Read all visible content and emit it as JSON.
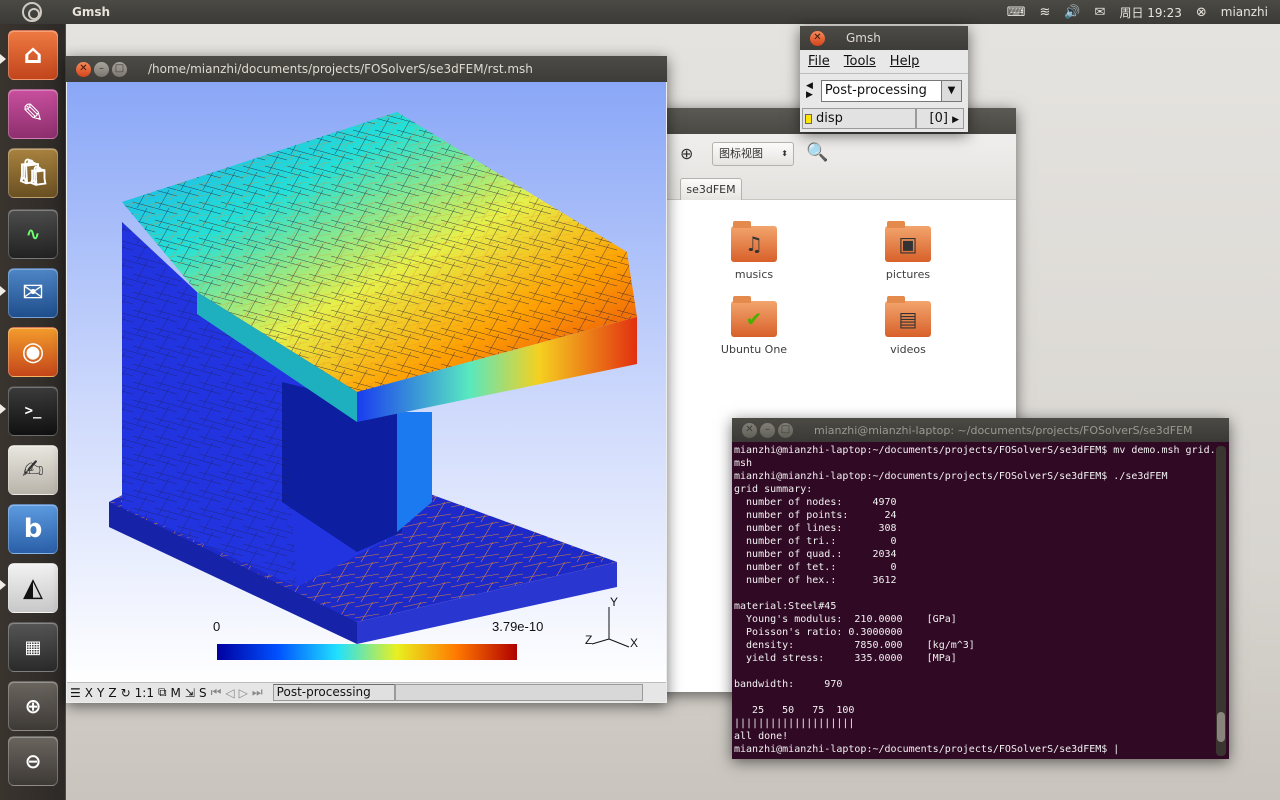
{
  "topbar": {
    "app_name": "Gmsh",
    "indicators": [
      "keyboard-icon",
      "wifi-icon",
      "volume-icon",
      "mail-icon"
    ],
    "clock": "周日 19:23",
    "user": "mianzhi"
  },
  "launcher": {
    "items": [
      "home-folder-icon",
      "system-settings-icon",
      "software-center-icon",
      "system-monitor-icon",
      "thunderbird-icon",
      "firefox-icon",
      "terminal-icon",
      "text-editor-icon",
      "blender-icon",
      "gmsh-icon",
      "workspace-switcher-icon",
      "zoom-icon",
      "zoom-out-icon",
      "trash-icon"
    ]
  },
  "gmsh_graphics": {
    "title": "/home/mianzhi/documents/projects/FOSolverS/se3dFEM/rst.msh",
    "colorbar_min": "0",
    "colorbar_max": "3.79e-10",
    "axis_x": "X",
    "axis_y": "Y",
    "axis_z": "Z",
    "status_buttons": [
      "X",
      "Y",
      "Z",
      "1:1",
      "M",
      "S"
    ],
    "status_module": "Post-processing"
  },
  "gmsh_menu": {
    "title": "Gmsh",
    "menus": [
      "File",
      "Tools",
      "Help"
    ],
    "module": "Post-processing",
    "view_name": "disp",
    "view_index": "[0]"
  },
  "nautilus": {
    "view_mode": "图标视图",
    "breadcrumb": "se3dFEM",
    "files": [
      "musics",
      "pictures",
      "Ubuntu One",
      "videos"
    ]
  },
  "terminal": {
    "title": "mianzhi@mianzhi-laptop: ~/documents/projects/FOSolverS/se3dFEM",
    "lines": [
      "mianzhi@mianzhi-laptop:~/documents/projects/FOSolverS/se3dFEM$ mv demo.msh grid.",
      "msh",
      "mianzhi@mianzhi-laptop:~/documents/projects/FOSolverS/se3dFEM$ ./se3dFEM",
      "grid summary:",
      "  number of nodes:     4970",
      "  number of points:      24",
      "  number of lines:      308",
      "  number of tri.:         0",
      "  number of quad.:     2034",
      "  number of tet.:         0",
      "  number of hex.:      3612",
      "",
      "material:Steel#45",
      "  Young's modulus:  210.0000    [GPa]",
      "  Poisson's ratio: 0.3000000",
      "  density:          7850.000    [kg/m^3]",
      "  yield stress:     335.0000    [MPa]",
      "",
      "bandwidth:     970",
      "",
      "   25   50   75  100",
      "||||||||||||||||||||",
      "all done!",
      "mianzhi@mianzhi-laptop:~/documents/projects/FOSolverS/se3dFEM$ |"
    ]
  }
}
